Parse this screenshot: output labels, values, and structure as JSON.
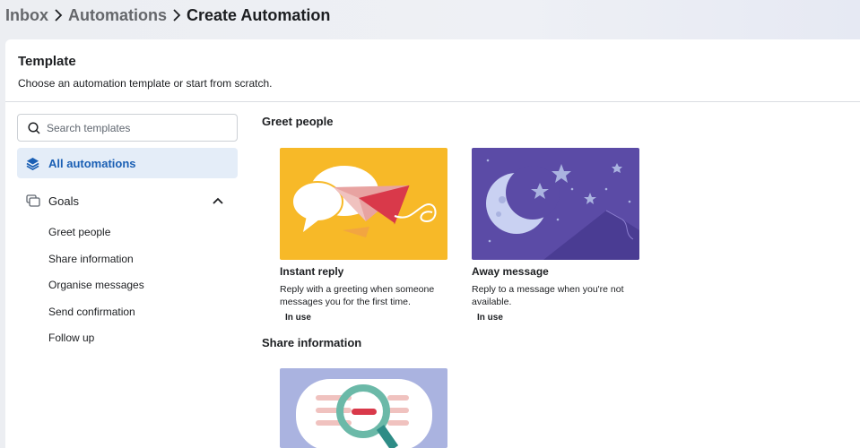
{
  "breadcrumb": {
    "items": [
      "Inbox",
      "Automations",
      "Create Automation"
    ]
  },
  "panel": {
    "title": "Template",
    "subtitle": "Choose an automation template or start from scratch."
  },
  "search": {
    "placeholder": "Search templates",
    "value": ""
  },
  "sidebar": {
    "all_label": "All automations",
    "goals_label": "Goals",
    "goal_items": [
      "Greet people",
      "Share information",
      "Organise messages",
      "Send confirmation",
      "Follow up"
    ]
  },
  "sections": [
    {
      "title": "Greet people",
      "cards": [
        {
          "title": "Instant reply",
          "description": "Reply with a greeting when someone messages you for the first time.",
          "badge": "In use",
          "image": "paper-plane-chat-bubbles-illustration"
        },
        {
          "title": "Away message",
          "description": "Reply to a message when you're not available.",
          "badge": "In use",
          "image": "moon-stars-night-illustration"
        }
      ]
    },
    {
      "title": "Share information",
      "cards": [
        {
          "image": "magnifying-glass-illustration"
        }
      ]
    }
  ],
  "colors": {
    "accent": "#1a5fb4",
    "selected_bg": "#e4edf8",
    "instant_reply_bg": "#f7b928",
    "away_message_bg": "#5b4ba6",
    "share_info_bg": "#aab3e0"
  }
}
